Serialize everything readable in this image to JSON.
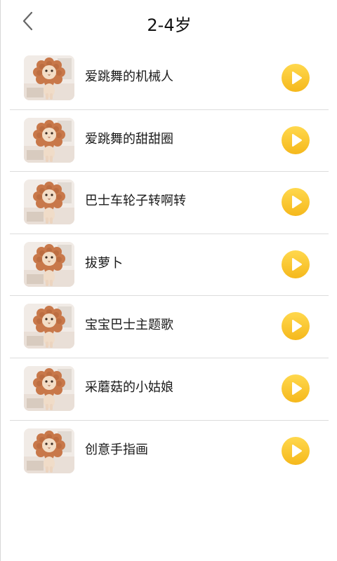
{
  "header": {
    "title": "2-4岁",
    "back_icon": "chevron-left-icon"
  },
  "colors": {
    "play_button": "#f7c12e",
    "divider": "#dcdcdc",
    "text": "#1a1a1a"
  },
  "songs": [
    {
      "title": "爱跳舞的机械人",
      "thumb_icon": "lion-cat-thumbnail",
      "action_icon": "play-icon"
    },
    {
      "title": "爱跳舞的甜甜圈",
      "thumb_icon": "lion-cat-thumbnail",
      "action_icon": "play-icon"
    },
    {
      "title": "巴士车轮子转啊转",
      "thumb_icon": "lion-cat-thumbnail",
      "action_icon": "play-icon"
    },
    {
      "title": "拔萝卜",
      "thumb_icon": "lion-cat-thumbnail",
      "action_icon": "play-icon"
    },
    {
      "title": "宝宝巴士主题歌",
      "thumb_icon": "lion-cat-thumbnail",
      "action_icon": "play-icon"
    },
    {
      "title": "采蘑菇的小姑娘",
      "thumb_icon": "lion-cat-thumbnail",
      "action_icon": "play-icon"
    },
    {
      "title": "创意手指画",
      "thumb_icon": "lion-cat-thumbnail",
      "action_icon": "play-icon"
    }
  ]
}
